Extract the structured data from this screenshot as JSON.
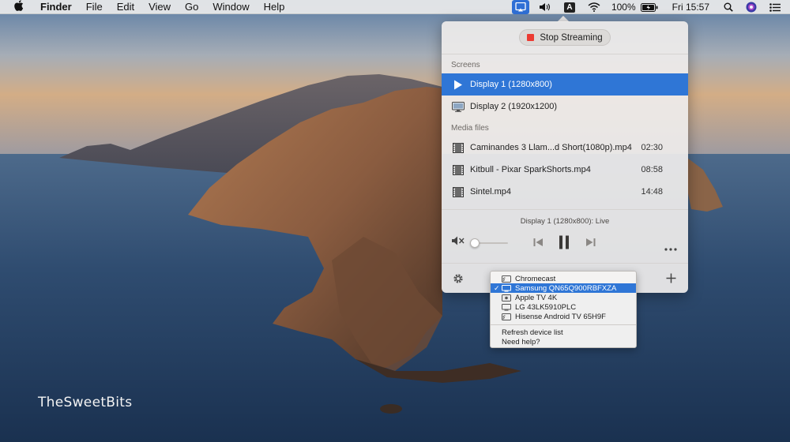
{
  "menubar": {
    "app_name": "Finder",
    "menus": [
      "File",
      "Edit",
      "View",
      "Go",
      "Window",
      "Help"
    ],
    "input_source": "A",
    "battery_percent": "100%",
    "clock": "Fri 15:57"
  },
  "popover": {
    "stop_label": "Stop Streaming",
    "screens_title": "Screens",
    "screens": [
      {
        "label": "Display 1 (1280x800)",
        "selected": true
      },
      {
        "label": "Display 2 (1920x1200)",
        "selected": false
      }
    ],
    "media_title": "Media files",
    "media": [
      {
        "name": "Caminandes 3  Llam...d Short(1080p).mp4",
        "duration": "02:30"
      },
      {
        "name": "Kitbull - Pixar SparkShorts.mp4",
        "duration": "08:58"
      },
      {
        "name": "Sintel.mp4",
        "duration": "14:48"
      }
    ],
    "now_playing": "Display 1 (1280x800): Live",
    "volume_level": 0.0
  },
  "devices_menu": {
    "devices": [
      {
        "name": "Chromecast",
        "checked": false,
        "icon": "cast-icon"
      },
      {
        "name": "Samsung QN65Q900RBFXZA",
        "checked": true,
        "icon": "tv-icon"
      },
      {
        "name": "Apple TV 4K",
        "checked": false,
        "icon": "appletv-icon"
      },
      {
        "name": "LG 43LK5910PLC",
        "checked": false,
        "icon": "tv-icon"
      },
      {
        "name": "Hisense Android TV 65H9F",
        "checked": false,
        "icon": "cast-icon"
      }
    ],
    "actions": [
      "Refresh device list",
      "Need help?"
    ]
  },
  "desktop": {
    "watermark": "TheSweetBits"
  },
  "colors": {
    "accent": "#2f76d6",
    "stop_red": "#ec3b32"
  }
}
